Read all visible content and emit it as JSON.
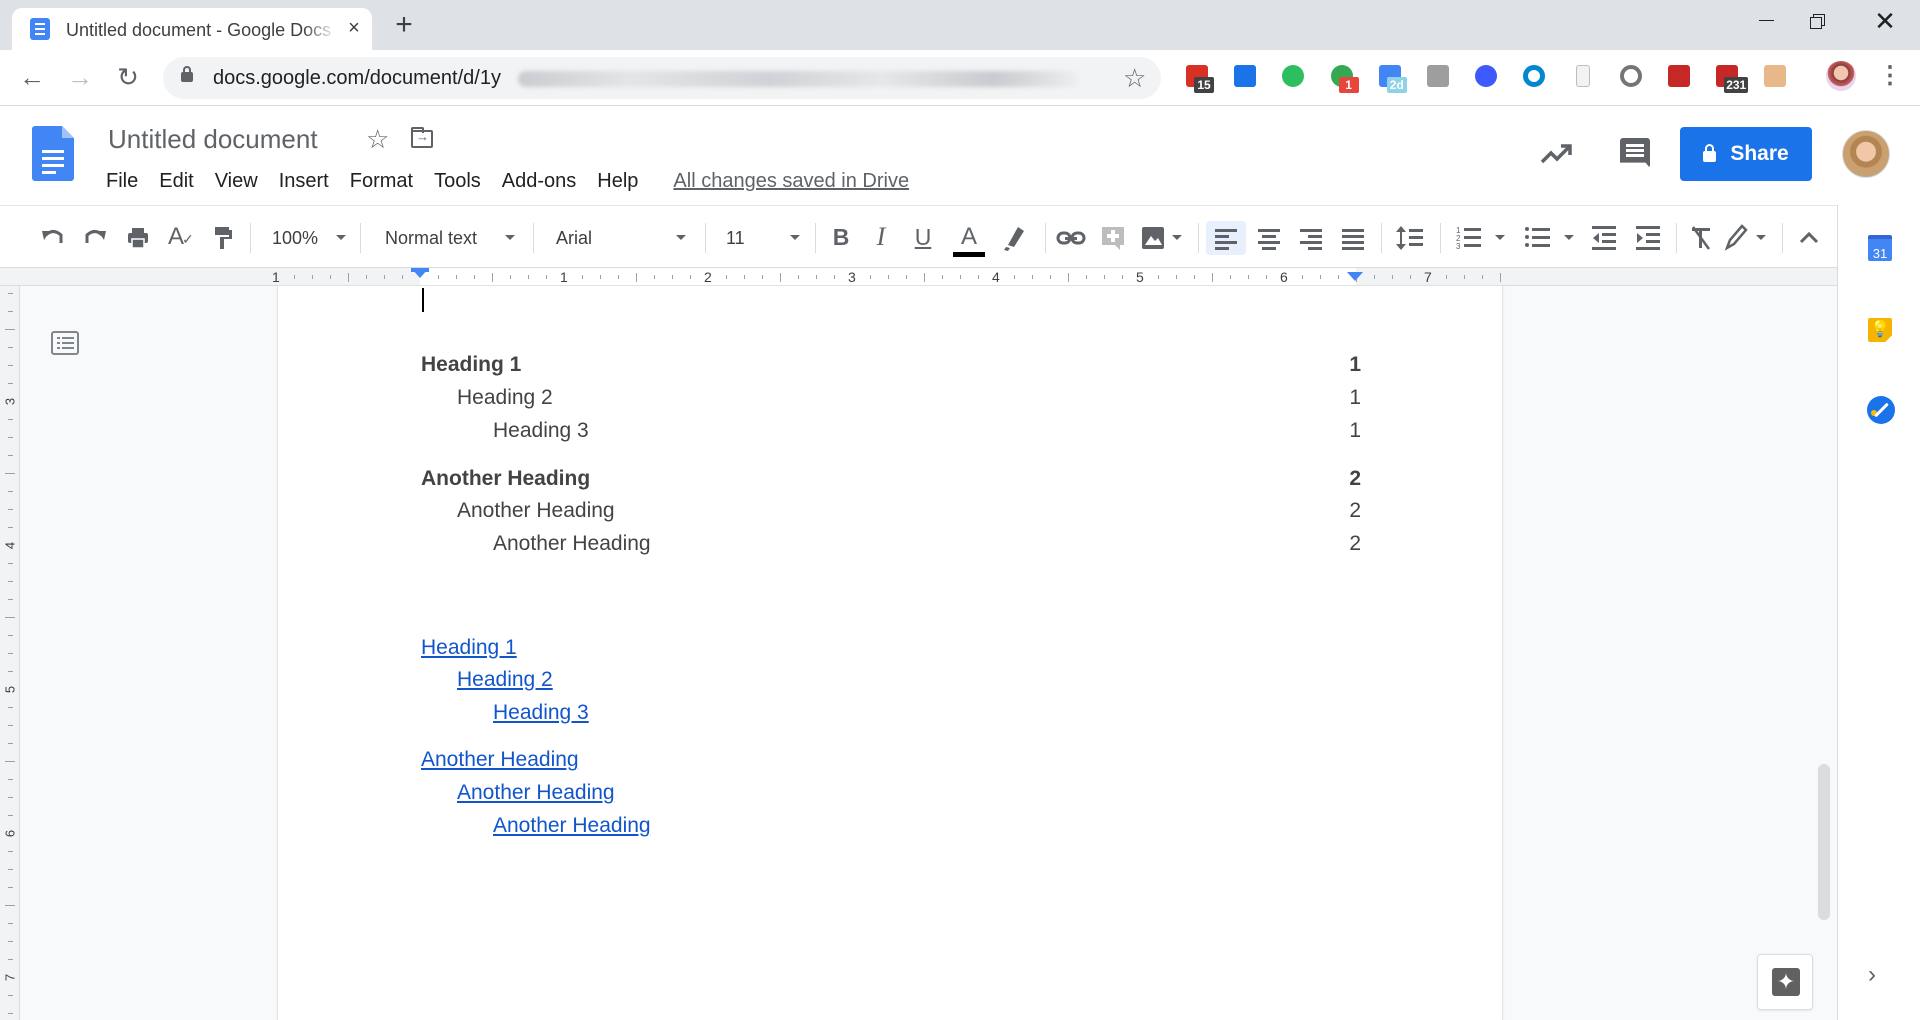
{
  "browser": {
    "tab_title": "Untitled document - Google Docs",
    "tab_close_icon": "×",
    "new_tab_icon": "+",
    "window_close_icon": "✕",
    "back_icon": "←",
    "forward_icon": "→",
    "reload_icon": "↻",
    "url": "docs.google.com/document/d/1y",
    "bookmark_icon": "☆",
    "extensions": [
      {
        "name": "extension-calendar-red",
        "badge": "15",
        "color": "#d93025",
        "badge_color": "#424242"
      },
      {
        "name": "extension-diamond",
        "badge": "",
        "color": "#1a73e8",
        "badge_color": ""
      },
      {
        "name": "extension-evernote",
        "badge": "",
        "color": "#2dbe60",
        "badge_color": ""
      },
      {
        "name": "extension-green-p",
        "badge": "1",
        "color": "#34a853",
        "badge_color": "#e8453c"
      },
      {
        "name": "extension-blue-box",
        "badge": "2d",
        "color": "#4285f4",
        "badge_color": "#8fd3e8"
      },
      {
        "name": "extension-bird",
        "badge": "",
        "color": "#9e9e9e",
        "badge_color": ""
      },
      {
        "name": "extension-v",
        "badge": "",
        "color": "#3d5afe",
        "badge_color": ""
      },
      {
        "name": "extension-ring",
        "badge": "",
        "color": "#0288d1",
        "badge_color": ""
      },
      {
        "name": "extension-plus-doc",
        "badge": "",
        "color": "#bdbdbd",
        "badge_color": ""
      },
      {
        "name": "extension-gray-circle",
        "badge": "",
        "color": "#757575",
        "badge_color": ""
      },
      {
        "name": "extension-mcafee",
        "badge": "",
        "color": "#c62828",
        "badge_color": ""
      },
      {
        "name": "extension-adblock",
        "badge": "231",
        "color": "#c62828",
        "badge_color": "#424242"
      },
      {
        "name": "extension-clipboard-face",
        "badge": "",
        "color": "#e6b88a",
        "badge_color": ""
      }
    ],
    "menu_icon": "⋮"
  },
  "header": {
    "doc_title": "Untitled document",
    "star_icon": "☆",
    "menu": [
      "File",
      "Edit",
      "View",
      "Insert",
      "Format",
      "Tools",
      "Add-ons",
      "Help"
    ],
    "save_status": "All changes saved in Drive",
    "share_label": "Share"
  },
  "toolbar": {
    "zoom": "100%",
    "style": "Normal text",
    "font": "Arial",
    "font_size": "11",
    "bold": "B",
    "italic": "I",
    "underline": "U",
    "text_color": "A",
    "text_color_value": "#000000",
    "collapse_icon": "^"
  },
  "ruler": {
    "labels": [
      "1",
      "1",
      "2",
      "3",
      "4",
      "5",
      "6",
      "7"
    ],
    "vertical_labels": [
      "3",
      "4",
      "5",
      "6",
      "7"
    ]
  },
  "document": {
    "toc_with_page_numbers": [
      {
        "level": 1,
        "text": "Heading 1",
        "page": "1"
      },
      {
        "level": 2,
        "text": "Heading 2",
        "page": "1"
      },
      {
        "level": 3,
        "text": "Heading 3",
        "page": "1"
      },
      {
        "level": 1,
        "text": "Another Heading",
        "page": "2"
      },
      {
        "level": 2,
        "text": "Another Heading",
        "page": "2"
      },
      {
        "level": 3,
        "text": "Another Heading",
        "page": "2"
      }
    ],
    "toc_with_links": [
      {
        "level": 1,
        "text": "Heading 1"
      },
      {
        "level": 2,
        "text": "Heading 2"
      },
      {
        "level": 3,
        "text": "Heading 3"
      },
      {
        "level": 1,
        "text": "Another Heading"
      },
      {
        "level": 2,
        "text": "Another Heading"
      },
      {
        "level": 3,
        "text": "Another Heading"
      }
    ],
    "link_color": "#1155cc"
  },
  "sidepanel": {
    "calendar_label": "31",
    "expand_icon": "›",
    "explore_icon": "✦"
  },
  "colors": {
    "accent": "#1a73e8",
    "docs_blue": "#4285f4",
    "text": "#434343"
  }
}
